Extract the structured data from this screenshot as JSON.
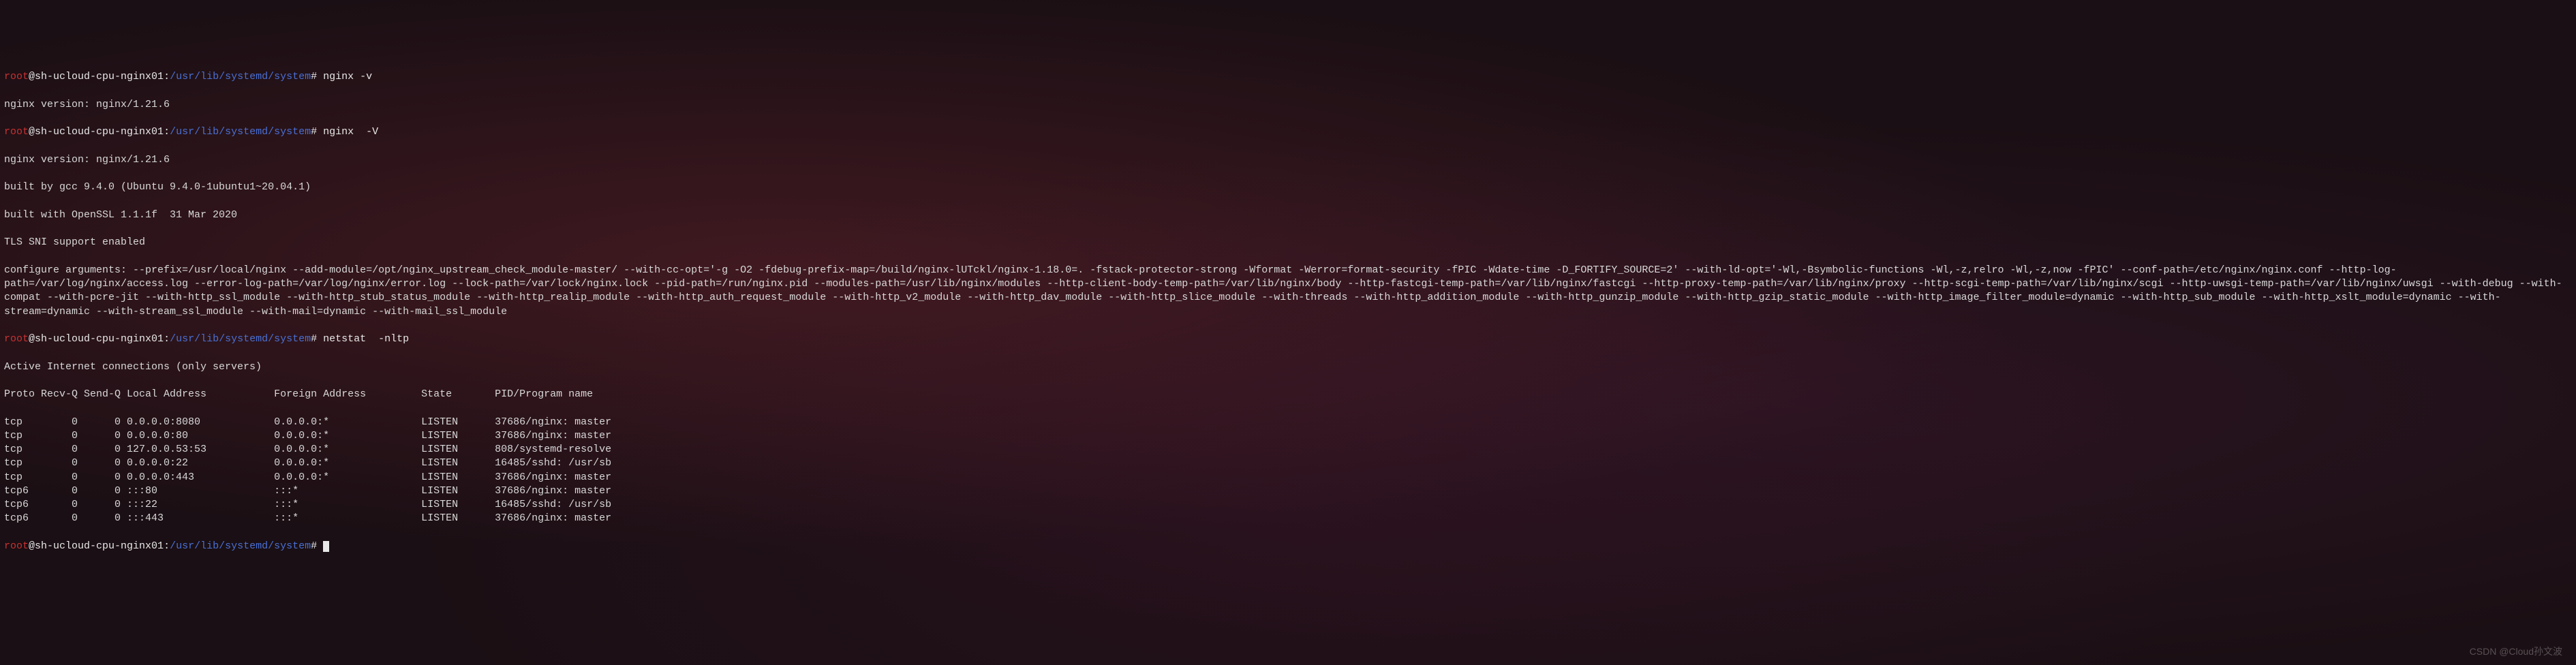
{
  "prompt": {
    "user": "root",
    "host": "sh-ucloud-cpu-nginx01",
    "path": "/usr/lib/systemd/system",
    "sep1": "@",
    "sep2": ":",
    "sep3": "#"
  },
  "commands": {
    "cmd1": "nginx -v",
    "cmd2": "nginx  -V",
    "cmd3": "netstat  -nltp"
  },
  "outputs": {
    "nginx_version": "nginx version: nginx/1.21.6",
    "built_by": "built by gcc 9.4.0 (Ubuntu 9.4.0-1ubuntu1~20.04.1)",
    "built_with": "built with OpenSSL 1.1.1f  31 Mar 2020",
    "tls_sni": "TLS SNI support enabled",
    "configure_args": "configure arguments: --prefix=/usr/local/nginx --add-module=/opt/nginx_upstream_check_module-master/ --with-cc-opt='-g -O2 -fdebug-prefix-map=/build/nginx-lUTckl/nginx-1.18.0=. -fstack-protector-strong -Wformat -Werror=format-security -fPIC -Wdate-time -D_FORTIFY_SOURCE=2' --with-ld-opt='-Wl,-Bsymbolic-functions -Wl,-z,relro -Wl,-z,now -fPIC' --conf-path=/etc/nginx/nginx.conf --http-log-path=/var/log/nginx/access.log --error-log-path=/var/log/nginx/error.log --lock-path=/var/lock/nginx.lock --pid-path=/run/nginx.pid --modules-path=/usr/lib/nginx/modules --http-client-body-temp-path=/var/lib/nginx/body --http-fastcgi-temp-path=/var/lib/nginx/fastcgi --http-proxy-temp-path=/var/lib/nginx/proxy --http-scgi-temp-path=/var/lib/nginx/scgi --http-uwsgi-temp-path=/var/lib/nginx/uwsgi --with-debug --with-compat --with-pcre-jit --with-http_ssl_module --with-http_stub_status_module --with-http_realip_module --with-http_auth_request_module --with-http_v2_module --with-http_dav_module --with-http_slice_module --with-threads --with-http_addition_module --with-http_gunzip_module --with-http_gzip_static_module --with-http_image_filter_module=dynamic --with-http_sub_module --with-http_xslt_module=dynamic --with-stream=dynamic --with-stream_ssl_module --with-mail=dynamic --with-mail_ssl_module",
    "netstat_header": "Active Internet connections (only servers)",
    "netstat_cols": "Proto Recv-Q Send-Q Local Address           Foreign Address         State       PID/Program name"
  },
  "netstat_rows": [
    {
      "proto": "tcp ",
      "recvq": "       0",
      "sendq": "      0",
      "local": " 0.0.0.0:8080           ",
      "foreign": " 0.0.0.0:*              ",
      "state": " LISTEN     ",
      "pid": " 37686/nginx: master"
    },
    {
      "proto": "tcp ",
      "recvq": "       0",
      "sendq": "      0",
      "local": " 0.0.0.0:80             ",
      "foreign": " 0.0.0.0:*              ",
      "state": " LISTEN     ",
      "pid": " 37686/nginx: master"
    },
    {
      "proto": "tcp ",
      "recvq": "       0",
      "sendq": "      0",
      "local": " 127.0.0.53:53          ",
      "foreign": " 0.0.0.0:*              ",
      "state": " LISTEN     ",
      "pid": " 808/systemd-resolve"
    },
    {
      "proto": "tcp ",
      "recvq": "       0",
      "sendq": "      0",
      "local": " 0.0.0.0:22             ",
      "foreign": " 0.0.0.0:*              ",
      "state": " LISTEN     ",
      "pid": " 16485/sshd: /usr/sb"
    },
    {
      "proto": "tcp ",
      "recvq": "       0",
      "sendq": "      0",
      "local": " 0.0.0.0:443            ",
      "foreign": " 0.0.0.0:*              ",
      "state": " LISTEN     ",
      "pid": " 37686/nginx: master"
    },
    {
      "proto": "tcp6",
      "recvq": "       0",
      "sendq": "      0",
      "local": " :::80                  ",
      "foreign": " :::*                   ",
      "state": " LISTEN     ",
      "pid": " 37686/nginx: master"
    },
    {
      "proto": "tcp6",
      "recvq": "       0",
      "sendq": "      0",
      "local": " :::22                  ",
      "foreign": " :::*                   ",
      "state": " LISTEN     ",
      "pid": " 16485/sshd: /usr/sb"
    },
    {
      "proto": "tcp6",
      "recvq": "       0",
      "sendq": "      0",
      "local": " :::443                 ",
      "foreign": " :::*                   ",
      "state": " LISTEN     ",
      "pid": " 37686/nginx: master"
    }
  ],
  "watermark": "CSDN @Cloud孙文波"
}
